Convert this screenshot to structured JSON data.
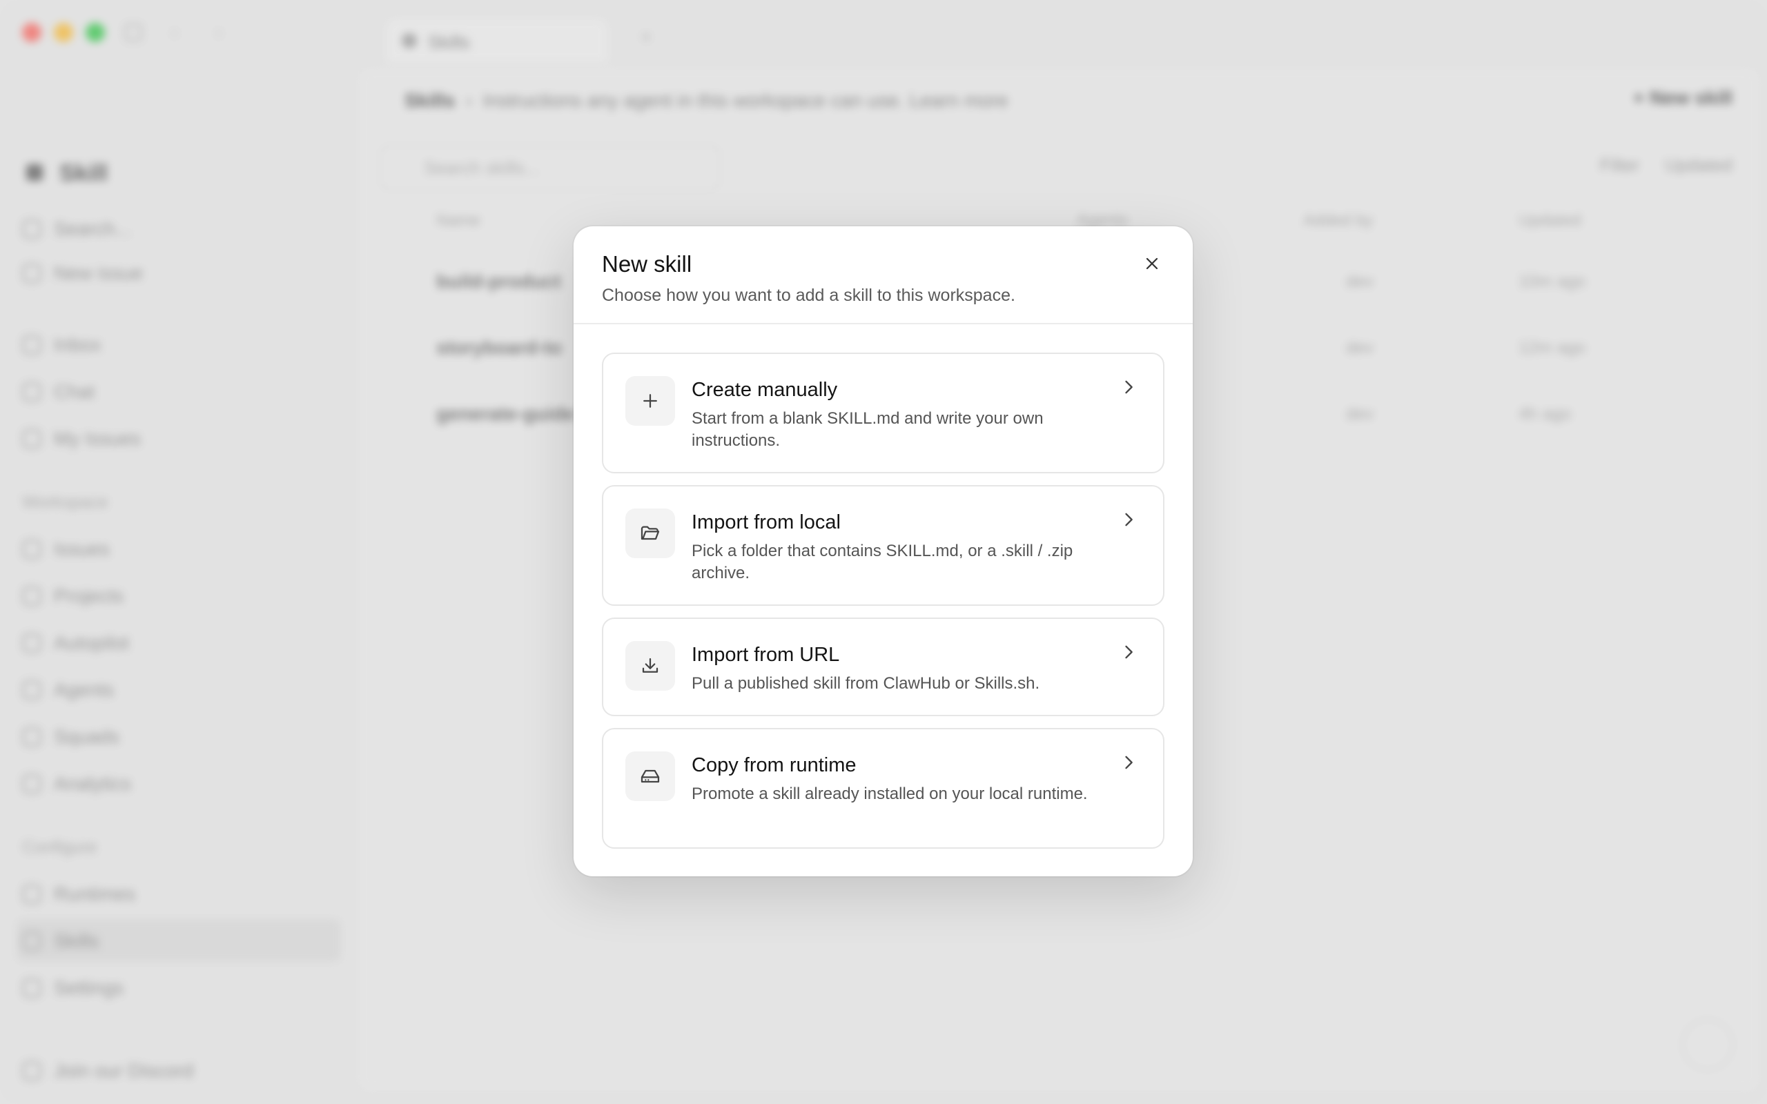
{
  "background": {
    "tab_label": "Skills",
    "workspace": "Skill",
    "sidebar": {
      "top_items": [
        "Search...",
        "New issue"
      ],
      "main_items": [
        "Inbox",
        "Chat",
        "My Issues"
      ],
      "workspace_section": "Workspace",
      "workspace_items": [
        "Issues",
        "Projects",
        "Autopilot",
        "Agents",
        "Squads",
        "Analytics"
      ],
      "configure_section": "Configure",
      "configure_items": [
        "Runtimes",
        "Skills",
        "Settings"
      ],
      "footer": "Join our Discord"
    },
    "main": {
      "breadcrumb": "Skills",
      "breadcrumb_desc": "Instructions any agent in this workspace can use. Learn more",
      "new_button": "+ New skill",
      "search_placeholder": "Search skills...",
      "filter_label": "Filter",
      "sort_label": "Updated",
      "columns": [
        "Name",
        "Agents",
        "Added by",
        "Updated"
      ],
      "rows": [
        {
          "name": "build-product",
          "added_by": "dev",
          "updated": "10m ago"
        },
        {
          "name": "storyboard-to",
          "added_by": "dev",
          "updated": "12m ago"
        },
        {
          "name": "generate-guide",
          "added_by": "dev",
          "updated": "4h ago"
        }
      ]
    }
  },
  "dialog": {
    "title": "New skill",
    "subtitle": "Choose how you want to add a skill to this workspace.",
    "options": [
      {
        "icon": "plus-icon",
        "title": "Create manually",
        "description": "Start from a blank SKILL.md and write your own instructions."
      },
      {
        "icon": "folder-open-icon",
        "title": "Import from local",
        "description": "Pick a folder that contains SKILL.md, or a .skill / .zip archive."
      },
      {
        "icon": "download-icon",
        "title": "Import from URL",
        "description": "Pull a published skill from ClawHub or Skills.sh."
      },
      {
        "icon": "hard-drive-icon",
        "title": "Copy from runtime",
        "description": "Promote a skill already installed on your local runtime."
      }
    ]
  }
}
